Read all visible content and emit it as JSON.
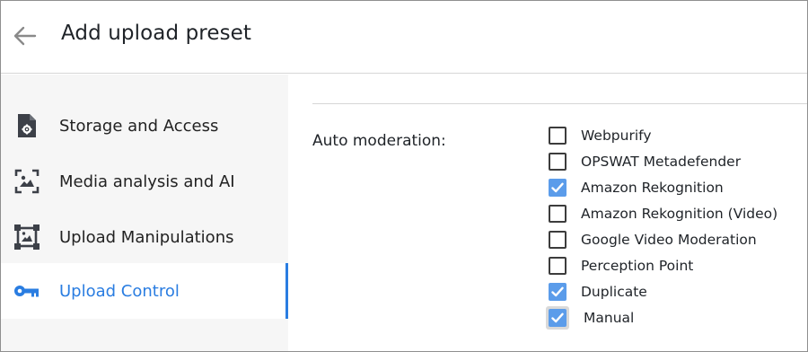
{
  "header": {
    "title": "Add upload preset",
    "back_icon": "arrow-left-icon"
  },
  "sidebar": {
    "items": [
      {
        "label": "Storage and Access",
        "icon": "file-gear-icon",
        "active": false
      },
      {
        "label": "Media analysis and AI",
        "icon": "image-frame-icon",
        "active": false
      },
      {
        "label": "Upload Manipulations",
        "icon": "crop-frame-icon",
        "active": false
      },
      {
        "label": "Upload Control",
        "icon": "key-icon",
        "active": true
      }
    ]
  },
  "main": {
    "auto_moderation_label": "Auto moderation:",
    "options": [
      {
        "label": "Webpurify",
        "checked": false
      },
      {
        "label": "OPSWAT Metadefender",
        "checked": false
      },
      {
        "label": "Amazon Rekognition",
        "checked": true
      },
      {
        "label": "Amazon Rekognition (Video)",
        "checked": false
      },
      {
        "label": "Google Video Moderation",
        "checked": false
      },
      {
        "label": "Perception Point",
        "checked": false
      },
      {
        "label": "Duplicate",
        "checked": true
      },
      {
        "label": "Manual",
        "checked": true
      }
    ]
  },
  "colors": {
    "accent": "#2a7de1",
    "checkbox_checked": "#5b9cea",
    "sidebar_bg": "#f6f6f6"
  }
}
